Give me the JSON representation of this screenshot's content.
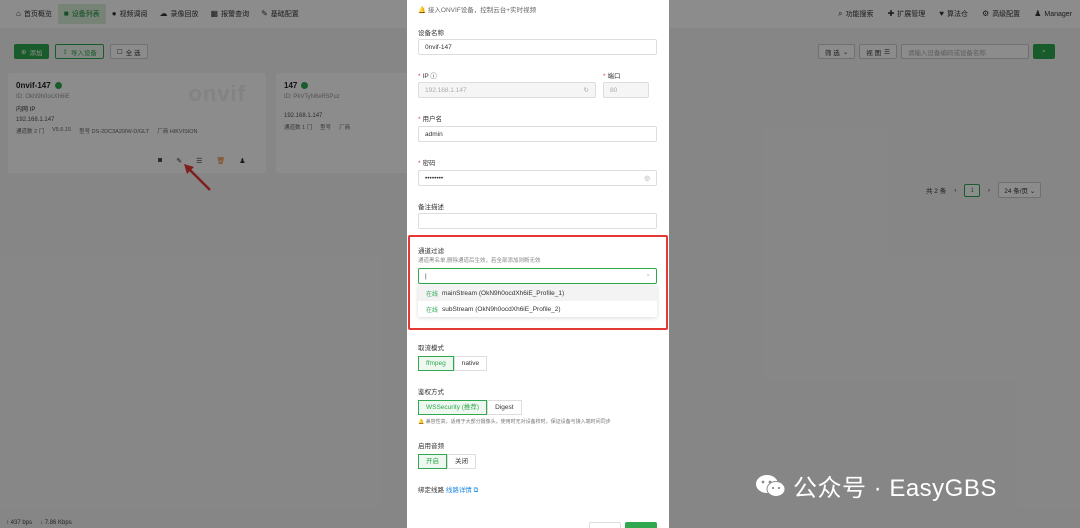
{
  "nav": {
    "items": [
      {
        "icon": "home-icon",
        "glyph": "⌂",
        "label": "首页概览"
      },
      {
        "icon": "video-icon",
        "glyph": "■",
        "label": "设备列表"
      },
      {
        "icon": "camera-icon",
        "glyph": "●",
        "label": "视频调阅"
      },
      {
        "icon": "cloud-icon",
        "glyph": "☁",
        "label": "录像回放"
      },
      {
        "icon": "calendar-icon",
        "glyph": "▦",
        "label": "报警查询"
      },
      {
        "icon": "edit-icon",
        "glyph": "✎",
        "label": "基础配置"
      }
    ],
    "right": [
      {
        "icon": "search-icon",
        "glyph": "⌕",
        "label": "功能搜索"
      },
      {
        "icon": "puzzle-icon",
        "glyph": "✚",
        "label": "扩展管理"
      },
      {
        "icon": "shield-icon",
        "glyph": "♥",
        "label": "算法仓"
      },
      {
        "icon": "gear-icon",
        "glyph": "⚙",
        "label": "高级配置"
      },
      {
        "icon": "user-icon",
        "glyph": "♟",
        "label": "Manager"
      }
    ]
  },
  "toolbar": {
    "add": "添加",
    "import": "导入设备",
    "select_all": "全 选",
    "filter": "筛 选",
    "view": "视 图",
    "search_placeholder": "请输入设备编码或设备名称"
  },
  "cards": [
    {
      "name": "0nvif-147",
      "id": "ID: OkN9h0ocXh6iE",
      "net": "内网 IP",
      "ip": "192.168.1.147",
      "channels": "通道数 2 门",
      "version": "V5.6.15",
      "model": "型号 DS-2DC3A20IW-D/GLT",
      "vendor": "厂商 HIKVISION",
      "logo": "onvif"
    },
    {
      "name": "147",
      "id": "ID: PkVTyN6eR5Puz",
      "net": "",
      "ip": "192.168.1.147",
      "channels": "通道数 1 门",
      "version": "",
      "model": "型号",
      "vendor": "厂商",
      "logo": ""
    }
  ],
  "pager": {
    "total": "共 2 条",
    "page": "1",
    "per_page": "24 条/页"
  },
  "modal": {
    "hint": "接入ONVIF设备，控制云台+实时视频",
    "device_name_label": "设备名称",
    "device_name_value": "0nvif-147",
    "ip_label": "IP",
    "ip_value": "192.168.1.147",
    "port_label": "端口",
    "port_value": "80",
    "user_label": "用户名",
    "user_value": "admin",
    "pwd_label": "密码",
    "pwd_value": "••••••••",
    "remark_label": "备注描述",
    "channel_filter_label": "通道过滤",
    "channel_filter_desc": "通道黑名单,删除通道后生效，若全部添加则断无效",
    "channel_filter_value": "|",
    "dd": [
      {
        "tag": "在线",
        "text": "mainStream (OkN9h0ocdXh6iE_Profile_1)"
      },
      {
        "tag": "在线",
        "text": "subStream (OkN9h0ocdXh6iE_Profile_2)"
      }
    ],
    "pull_mode_label": "取流模式",
    "pull_modes": [
      "ffmpeg",
      "native"
    ],
    "auth_label": "鉴权方式",
    "auth_modes": [
      "WSSecurity (推荐)",
      "Digest"
    ],
    "auth_note": "兼容性高，适用于大部分摄像头，使用时无对设备校时，保证设备与接入端时间同步",
    "enable_label": "启用音频",
    "enable_modes": [
      "开启",
      "关闭"
    ],
    "bind_label": "绑定线路",
    "bind_link": "线路详情"
  },
  "status": {
    "up": "↑ 437 bps",
    "down": "↓ 7.86 Kbps"
  },
  "watermark": "公众号 · EasyGBS",
  "colors": {
    "accent": "#2fa84f",
    "highlight": "#e53935"
  }
}
